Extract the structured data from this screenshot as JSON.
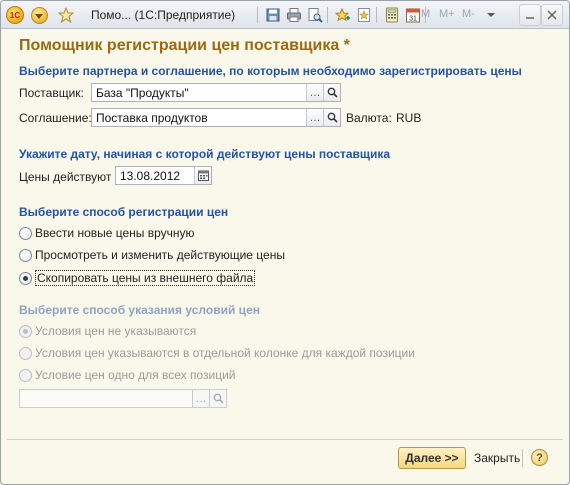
{
  "window": {
    "title": "Помо...  (1С:Предприятие)",
    "logo_text": "1С",
    "memory_buttons": [
      "M",
      "M+",
      "M-"
    ]
  },
  "form": {
    "title": "Помощник регистрации цен поставщика *",
    "section_partner": "Выберите партнера и соглашение, по которым необходимо зарегистрировать цены",
    "supplier_label": "Поставщик:",
    "supplier_value": "База \"Продукты\"",
    "agreement_label": "Соглашение:",
    "agreement_value": "Поставка продуктов",
    "currency_label": "Валюта:",
    "currency_value": "RUB",
    "section_date": "Укажите дату, начиная с которой действуют цены поставщика",
    "date_label": "Цены действуют с:",
    "date_value": "13.08.2012",
    "section_method": "Выберите способ регистрации цен",
    "method_options": [
      {
        "label": "Ввести новые цены вручную",
        "selected": false
      },
      {
        "label": "Просмотреть и изменить действующие цены",
        "selected": false
      },
      {
        "label": "Скопировать цены из внешнего файла",
        "selected": true
      }
    ],
    "section_conditions": "Выберите способ указания условий цен",
    "condition_options": [
      {
        "label": "Условия цен не указываются",
        "selected": true
      },
      {
        "label": "Условия цен указываются в отдельной колонке для каждой позиции",
        "selected": false
      },
      {
        "label": "Условие цен одно для всех позиций",
        "selected": false
      }
    ],
    "condition_value": ""
  },
  "footer": {
    "next_label": "Далее >>",
    "close_label": "Закрыть",
    "help_label": "?"
  },
  "colors": {
    "title": "#9c6a11",
    "section": "#2453a4",
    "background": "#faf8eb"
  }
}
